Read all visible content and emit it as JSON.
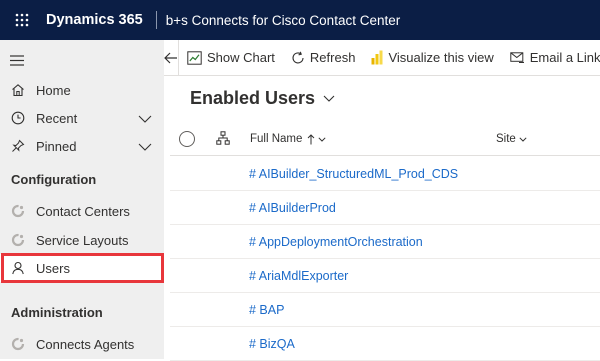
{
  "header": {
    "brand": "Dynamics 365",
    "app_name": "b+s Connects for Cisco Contact Center"
  },
  "sidebar": {
    "items_top": [
      {
        "label": "Home",
        "icon": "home-icon"
      },
      {
        "label": "Recent",
        "icon": "clock-icon"
      },
      {
        "label": "Pinned",
        "icon": "pin-icon"
      }
    ],
    "section_configuration": "Configuration",
    "config_items": [
      {
        "label": "Contact Centers",
        "icon": "entity-icon"
      },
      {
        "label": "Service Layouts",
        "icon": "entity-icon"
      },
      {
        "label": "Users",
        "icon": "person-icon"
      }
    ],
    "section_administration": "Administration",
    "admin_items": [
      {
        "label": "Connects Agents",
        "icon": "entity-icon"
      }
    ]
  },
  "commands": {
    "show_chart": "Show Chart",
    "refresh": "Refresh",
    "visualize": "Visualize this view",
    "email_link": "Email a Link"
  },
  "view": {
    "title": "Enabled Users",
    "columns": {
      "full_name": "Full Name",
      "site": "Site"
    },
    "rows": [
      "# AIBuilder_StructuredML_Prod_CDS",
      "# AIBuilderProd",
      "# AppDeploymentOrchestration",
      "# AriaMdlExporter",
      "# BAP",
      "# BizQA"
    ]
  },
  "colors": {
    "topbar": "#0b1e45",
    "link": "#1b6ac9",
    "highlight": "#e8363b",
    "powerbi": "#f2c811"
  }
}
